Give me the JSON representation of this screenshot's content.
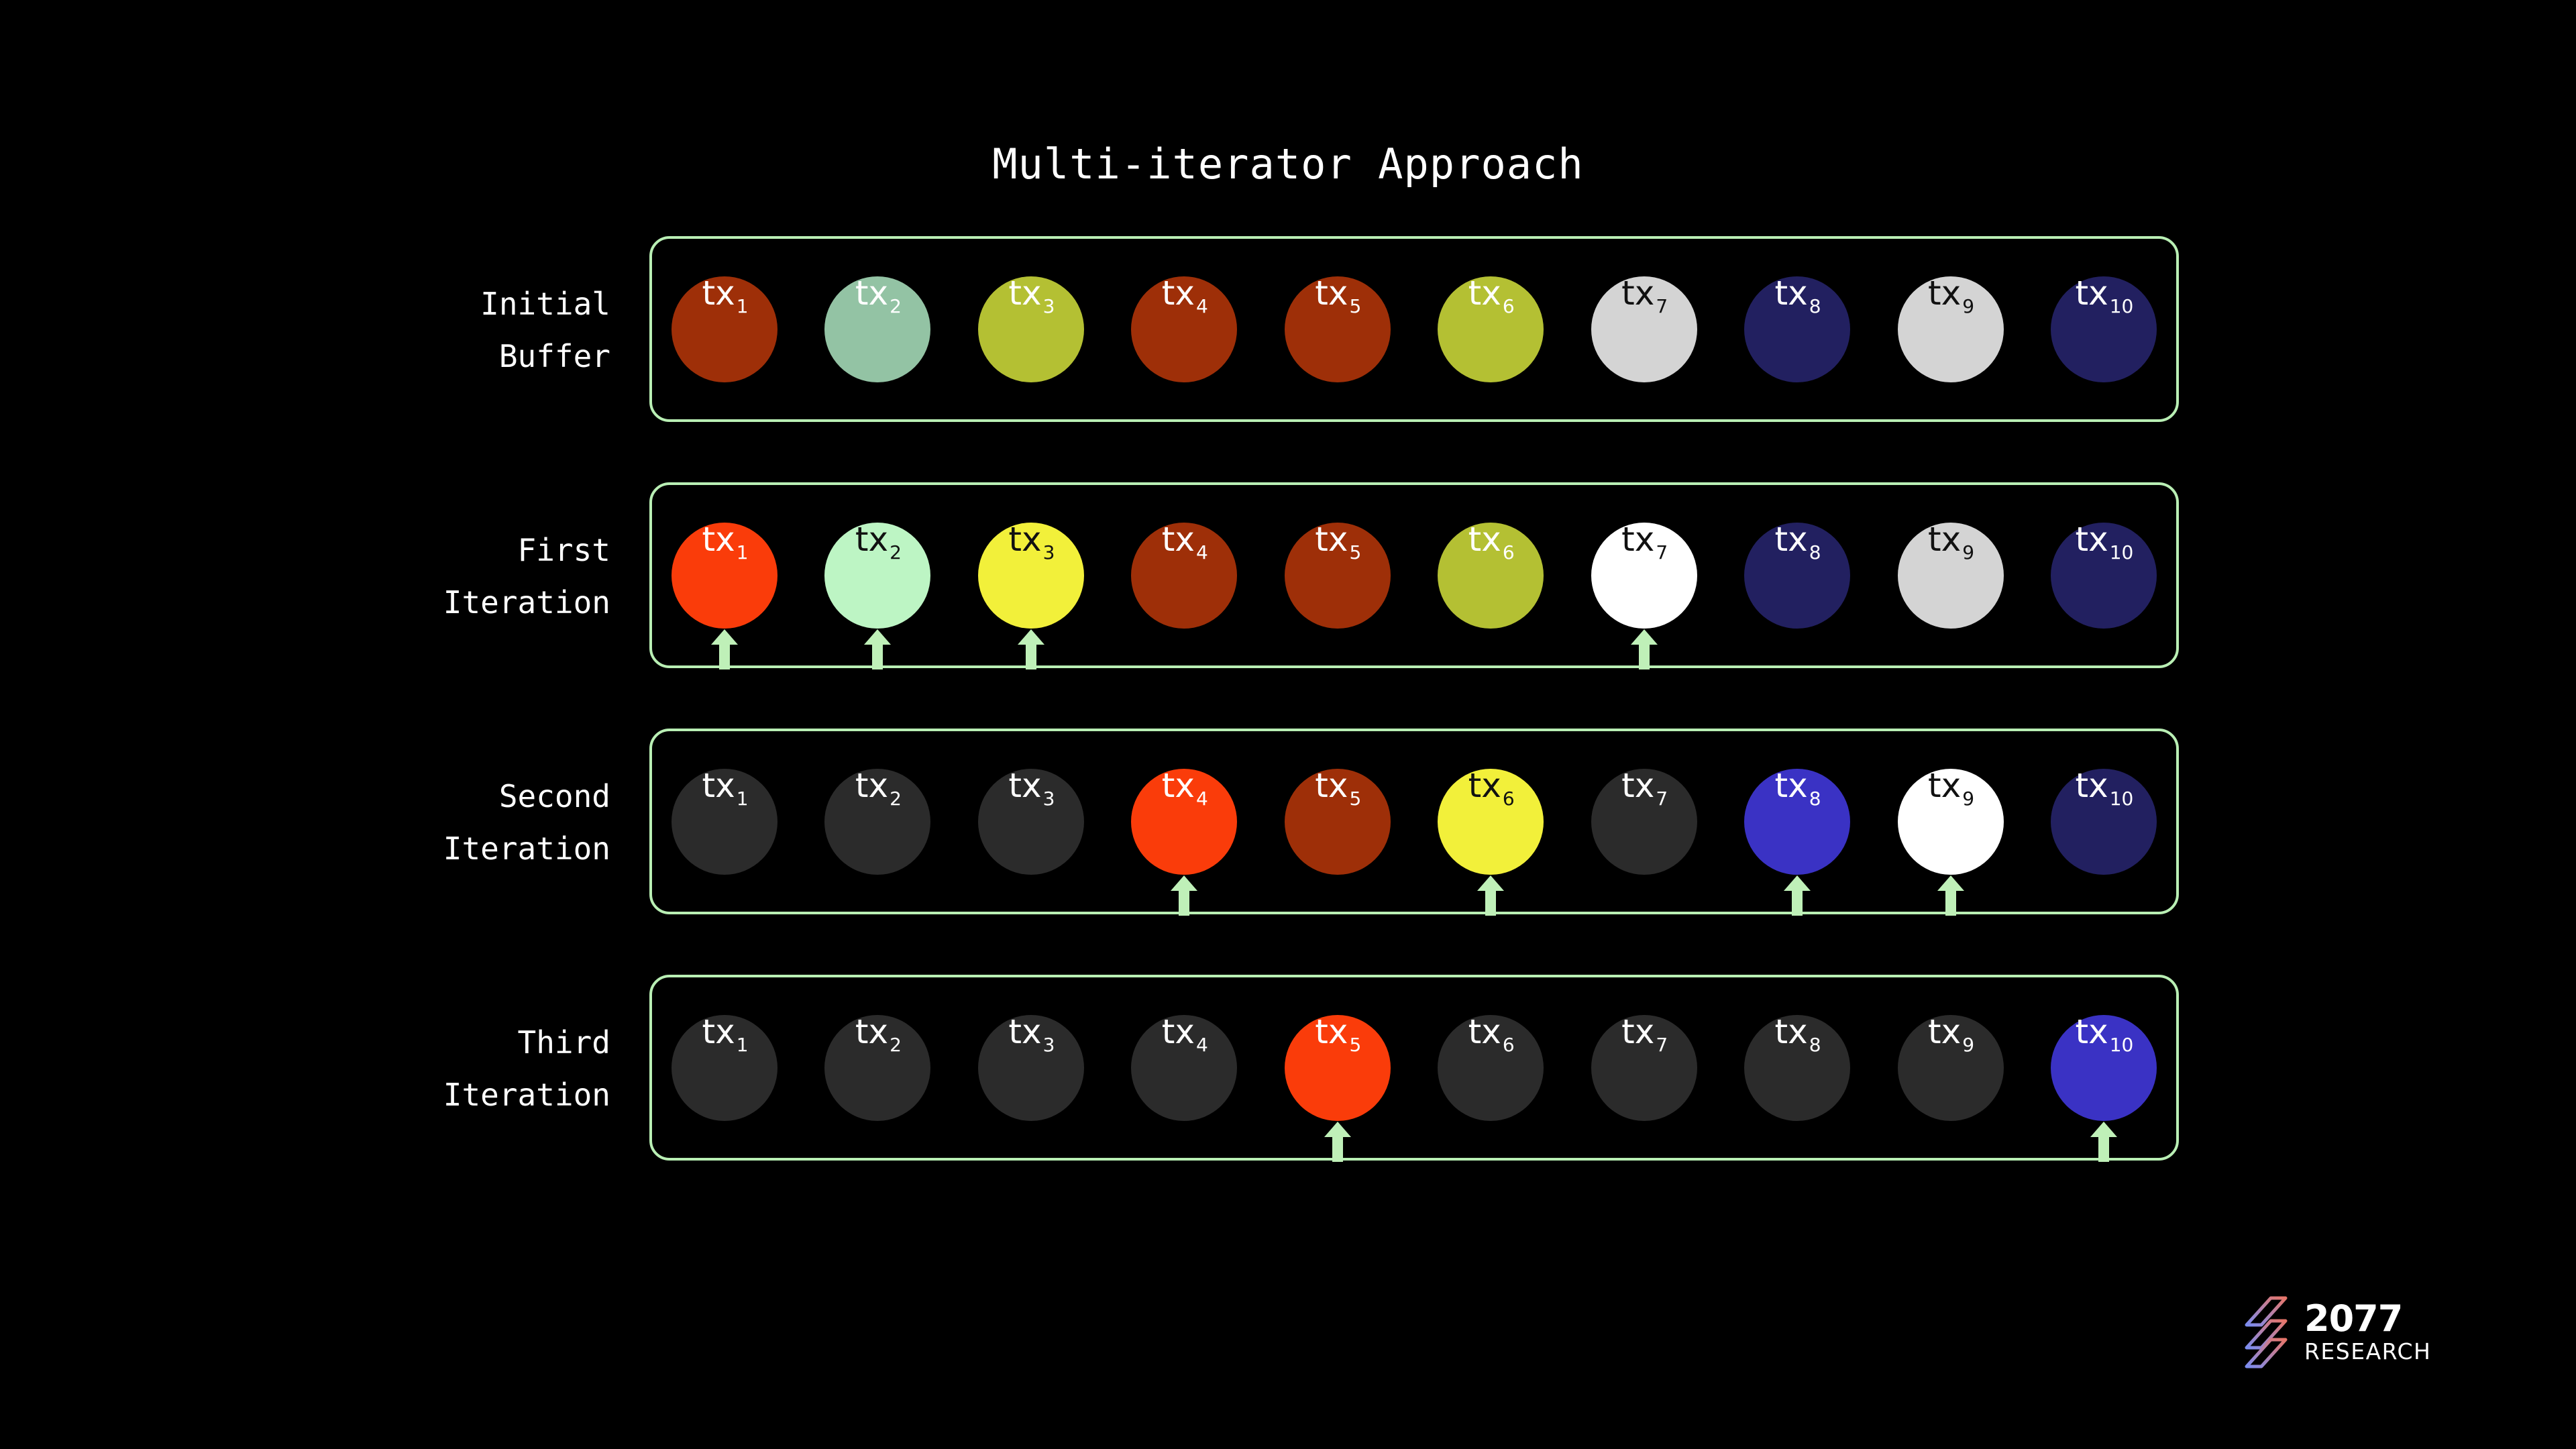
{
  "title": "Multi-iterator Approach",
  "legend_colors": {
    "buffer_border": "#b9efb4",
    "arrow": "#bff0b8",
    "background": "#000000",
    "consumed": "#2b2b2b",
    "consumed_text": "#ffffff"
  },
  "tx_labels": [
    "tx",
    "tx",
    "tx",
    "tx",
    "tx",
    "tx",
    "tx",
    "tx",
    "tx",
    "tx"
  ],
  "tx_subs": [
    "1",
    "2",
    "3",
    "4",
    "5",
    "6",
    "7",
    "8",
    "9",
    "10"
  ],
  "rows": [
    {
      "label": "Initial\nBuffer",
      "name": "initial-buffer",
      "cells": [
        {
          "label": "tx",
          "sub": "1",
          "fill": "#9e2f08",
          "text": "#ffffff",
          "state": "pending",
          "arrow": false
        },
        {
          "label": "tx",
          "sub": "2",
          "fill": "#93c3a4",
          "text": "#ffffff",
          "state": "pending",
          "arrow": false
        },
        {
          "label": "tx",
          "sub": "3",
          "fill": "#b4c033",
          "text": "#ffffff",
          "state": "pending",
          "arrow": false
        },
        {
          "label": "tx",
          "sub": "4",
          "fill": "#9e2f08",
          "text": "#ffffff",
          "state": "pending",
          "arrow": false
        },
        {
          "label": "tx",
          "sub": "5",
          "fill": "#9e2f08",
          "text": "#ffffff",
          "state": "pending",
          "arrow": false
        },
        {
          "label": "tx",
          "sub": "6",
          "fill": "#b4c033",
          "text": "#ffffff",
          "state": "pending",
          "arrow": false
        },
        {
          "label": "tx",
          "sub": "7",
          "fill": "#d4d4d4",
          "text": "#111111",
          "state": "pending",
          "arrow": false
        },
        {
          "label": "tx",
          "sub": "8",
          "fill": "#222060",
          "text": "#ffffff",
          "state": "pending",
          "arrow": false
        },
        {
          "label": "tx",
          "sub": "9",
          "fill": "#d4d4d4",
          "text": "#111111",
          "state": "pending",
          "arrow": false
        },
        {
          "label": "tx",
          "sub": "10",
          "fill": "#222060",
          "text": "#ffffff",
          "state": "pending",
          "arrow": false
        }
      ]
    },
    {
      "label": "First\nIteration",
      "name": "first-iteration",
      "cells": [
        {
          "label": "tx",
          "sub": "1",
          "fill": "#fa3c0a",
          "text": "#ffffff",
          "state": "active",
          "arrow": true
        },
        {
          "label": "tx",
          "sub": "2",
          "fill": "#bdf5c4",
          "text": "#111111",
          "state": "active",
          "arrow": true
        },
        {
          "label": "tx",
          "sub": "3",
          "fill": "#f2f03a",
          "text": "#111111",
          "state": "active",
          "arrow": true
        },
        {
          "label": "tx",
          "sub": "4",
          "fill": "#9e2f08",
          "text": "#ffffff",
          "state": "pending",
          "arrow": false
        },
        {
          "label": "tx",
          "sub": "5",
          "fill": "#9e2f08",
          "text": "#ffffff",
          "state": "pending",
          "arrow": false
        },
        {
          "label": "tx",
          "sub": "6",
          "fill": "#b4c033",
          "text": "#ffffff",
          "state": "pending",
          "arrow": false
        },
        {
          "label": "tx",
          "sub": "7",
          "fill": "#ffffff",
          "text": "#111111",
          "state": "active",
          "arrow": true
        },
        {
          "label": "tx",
          "sub": "8",
          "fill": "#222060",
          "text": "#ffffff",
          "state": "pending",
          "arrow": false
        },
        {
          "label": "tx",
          "sub": "9",
          "fill": "#d4d4d4",
          "text": "#111111",
          "state": "pending",
          "arrow": false
        },
        {
          "label": "tx",
          "sub": "10",
          "fill": "#222060",
          "text": "#ffffff",
          "state": "pending",
          "arrow": false
        }
      ]
    },
    {
      "label": "Second\nIteration",
      "name": "second-iteration",
      "cells": [
        {
          "label": "tx",
          "sub": "1",
          "fill": "#2b2b2b",
          "text": "#ffffff",
          "state": "consumed",
          "arrow": false
        },
        {
          "label": "tx",
          "sub": "2",
          "fill": "#2b2b2b",
          "text": "#ffffff",
          "state": "consumed",
          "arrow": false
        },
        {
          "label": "tx",
          "sub": "3",
          "fill": "#2b2b2b",
          "text": "#ffffff",
          "state": "consumed",
          "arrow": false
        },
        {
          "label": "tx",
          "sub": "4",
          "fill": "#fa3c0a",
          "text": "#ffffff",
          "state": "active",
          "arrow": true
        },
        {
          "label": "tx",
          "sub": "5",
          "fill": "#9e2f08",
          "text": "#ffffff",
          "state": "pending",
          "arrow": false
        },
        {
          "label": "tx",
          "sub": "6",
          "fill": "#f2f03a",
          "text": "#111111",
          "state": "active",
          "arrow": true
        },
        {
          "label": "tx",
          "sub": "7",
          "fill": "#2b2b2b",
          "text": "#ffffff",
          "state": "consumed",
          "arrow": false
        },
        {
          "label": "tx",
          "sub": "8",
          "fill": "#3a32c4",
          "text": "#ffffff",
          "state": "active",
          "arrow": true
        },
        {
          "label": "tx",
          "sub": "9",
          "fill": "#ffffff",
          "text": "#111111",
          "state": "active",
          "arrow": true
        },
        {
          "label": "tx",
          "sub": "10",
          "fill": "#222060",
          "text": "#ffffff",
          "state": "pending",
          "arrow": false
        }
      ]
    },
    {
      "label": "Third\nIteration",
      "name": "third-iteration",
      "cells": [
        {
          "label": "tx",
          "sub": "1",
          "fill": "#2b2b2b",
          "text": "#ffffff",
          "state": "consumed",
          "arrow": false
        },
        {
          "label": "tx",
          "sub": "2",
          "fill": "#2b2b2b",
          "text": "#ffffff",
          "state": "consumed",
          "arrow": false
        },
        {
          "label": "tx",
          "sub": "3",
          "fill": "#2b2b2b",
          "text": "#ffffff",
          "state": "consumed",
          "arrow": false
        },
        {
          "label": "tx",
          "sub": "4",
          "fill": "#2b2b2b",
          "text": "#ffffff",
          "state": "consumed",
          "arrow": false
        },
        {
          "label": "tx",
          "sub": "5",
          "fill": "#fa3c0a",
          "text": "#ffffff",
          "state": "active",
          "arrow": true
        },
        {
          "label": "tx",
          "sub": "6",
          "fill": "#2b2b2b",
          "text": "#ffffff",
          "state": "consumed",
          "arrow": false
        },
        {
          "label": "tx",
          "sub": "7",
          "fill": "#2b2b2b",
          "text": "#ffffff",
          "state": "consumed",
          "arrow": false
        },
        {
          "label": "tx",
          "sub": "8",
          "fill": "#2b2b2b",
          "text": "#ffffff",
          "state": "consumed",
          "arrow": false
        },
        {
          "label": "tx",
          "sub": "9",
          "fill": "#2b2b2b",
          "text": "#ffffff",
          "state": "consumed",
          "arrow": false
        },
        {
          "label": "tx",
          "sub": "10",
          "fill": "#3a32c4",
          "text": "#ffffff",
          "state": "active",
          "arrow": true
        }
      ]
    }
  ],
  "logo": {
    "name": "2077 Research",
    "primary": "2077",
    "secondary": "RESEARCH",
    "gradient_from": "#7b8cf0",
    "gradient_to": "#e8766a"
  }
}
